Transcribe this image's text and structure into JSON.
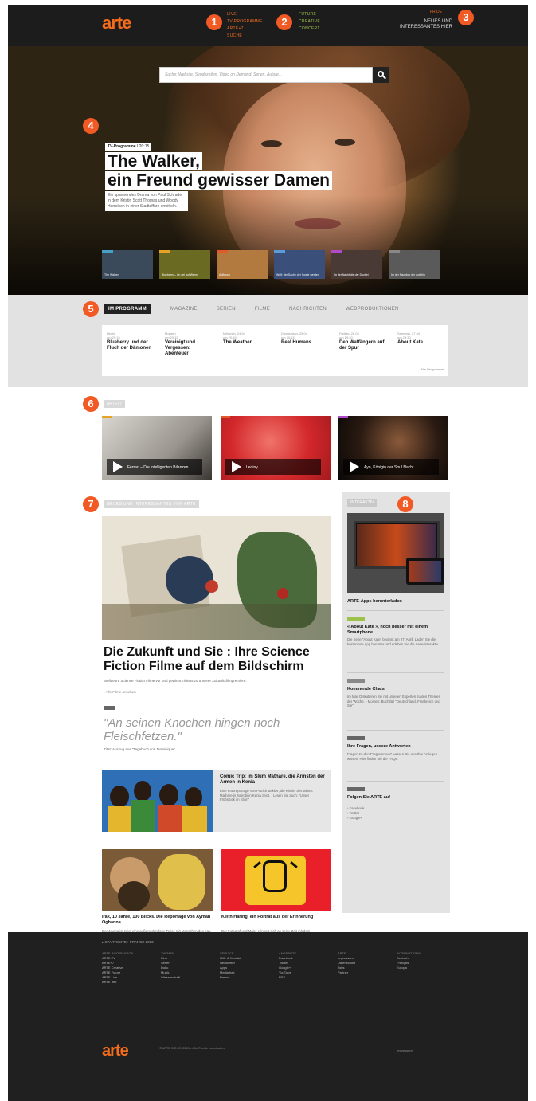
{
  "header": {
    "logo": "arte",
    "nav_col1": [
      "LIVE",
      "TV-PROGRAMME",
      "ARTE+7",
      "SUCHE"
    ],
    "nav_col2": [
      "FUTURE",
      "CREATIVE",
      "CONCERT"
    ],
    "lang": "FR DE",
    "news": "NEUES UND INTERESSANTES HIER"
  },
  "badges": [
    "1",
    "2",
    "3",
    "4",
    "5",
    "6",
    "7",
    "8"
  ],
  "hero": {
    "search_placeholder": "Suche: Website, Sendezeiten, Video on Demand, Serien, Autore...",
    "kicker_label": "TV-Programme",
    "kicker_time": "I 20:15",
    "title_line1": "The Walker,",
    "title_line2": "ein Freund gewisser Damen",
    "description": "Ein spannendes Drama von Paul Schrader in dem Kristin Scott Thomas und Woody Harrelson in einer Stadtaffäre ermitteln.",
    "thumbs": [
      {
        "caption": "The Walker",
        "color": "#3a4a5a",
        "tag": "#47a0c8"
      },
      {
        "caption": "Blueberry – Un del auf Wenn",
        "color": "#6b6a22",
        "tag": "#e6a326"
      },
      {
        "caption": "Aufbruch",
        "color": "#b27a3f",
        "tag": "#e35a2a"
      },
      {
        "caption": "Wolf: der Sache der Sowie werden",
        "color": "#3a4f7a",
        "tag": "#5a9bd8"
      },
      {
        "caption": "Im der Nacht die der Dunkel",
        "color": "#4a3a36",
        "tag": "#b04ac8"
      },
      {
        "caption": "Im der Nachbar der dort hin",
        "color": "#5a5a5a",
        "tag": "#888888"
      }
    ]
  },
  "programme": {
    "tabs": [
      "IM PROGRAMM",
      "MAGAZINE",
      "SERIEN",
      "FILME",
      "NACHRICHTEN",
      "WEBPRODUKTIONEN"
    ],
    "items": [
      {
        "day": "Heute",
        "time": "um 20:15",
        "title": "Blueberry und der Fluch der Dämonen"
      },
      {
        "day": "Morgen",
        "time": "um 20:15",
        "title": "Vereinigt und Vergessen: Abenteuer"
      },
      {
        "day": "Mittwoch, 24.04",
        "time": "um 20:15",
        "title": "The Weather"
      },
      {
        "day": "Donnerstag, 25.04",
        "time": "um 20:15",
        "title": "Real Humans"
      },
      {
        "day": "Freitag, 26.04",
        "time": "um 19:30",
        "title": "Den Waffängern auf der Spur"
      },
      {
        "day": "Samstag, 27.04",
        "time": "um 23:30",
        "title": "About Kate"
      }
    ],
    "all_link": "Alle Programme"
  },
  "videos": {
    "label": "ARTE+7",
    "items": [
      {
        "title": "Ferrari – Die intelligenten Bilanzen",
        "tag": "#e6a326"
      },
      {
        "title": "Leoiny",
        "tag": "#e35a2a"
      },
      {
        "title": "Ayo, Königin der Soul Nacht",
        "tag": "#b04ac8"
      }
    ]
  },
  "articles": {
    "label": "NEUES UND INTERESSANTES VON ARTE",
    "feature_title": "Die Zukunft und Sie : Ihre Science Fiction Filme auf dem Bildschirm",
    "feature_desc": "Stellt eure Science Fiction Filme vor und gewinnt Tickets zu unserer Zukunftsfilmpremiere.",
    "feature_link": "› Alle Filme ansehen",
    "quote": "\"An seinen Knochen hingen noch Fleischfetzen.\"",
    "quote_src": "Zitat: Auszug aus \"Tagebuch von Dominique\"",
    "card1_title": "Comic Trip: Im Slum Mathare, die Ärmsten der Armen in Kenia",
    "card1_desc": "Eine Fotoreportage von Patrick Bakker, die Kinder des Slums Mathare in Nairobi in Kenia zeigt. › Lesen Sie auch: \"Unser Frühstück im Slum\"",
    "card2_title": "Irak, 10 Jahre, 100 Blicks. Die Reportage von Ayman Oghanna",
    "card2_desc": "Der Journalist zeigt eine außerordentliche Reise mit Menschen des Irak, die Freude und Leid erlebt haben.",
    "card3_title": "Keith Haring, ein Porträt aus der Erinnerung",
    "card3_desc": "Der Fotograf und Maler erinnert sich an seine Zeit mit dem amerikanischen Künstler Haring."
  },
  "sidebar": {
    "label": "INTERAKTIV",
    "apps_title": "ARTE-Apps herunterladen",
    "s1_title": "« About Kate », noch besser mit einem Smartphone",
    "s1_text": "Die Serie \"About Kate\" beginnt am 27. April. Laden Sie die kostenlose App herunter und erleben Sie die Serie interaktiv.",
    "s2_title": "Kommende Chats",
    "s2_text": "Im Mai: Diskutieren Sie mit unseren Experten zu den Themen der Woche. › Morgen: Buchtitel \"Deutschland, Frankreich und Sie\"",
    "s3_title": "Ihre Fragen, unsere Antworten",
    "s3_text": "Fragen zu den Programmen? Lassen Sie uns Ihre Anliegen wissen. Hier finden Sie die FAQs.",
    "s4_title": "Folgen Sie ARTE auf",
    "s4_links": [
      "› Facebook",
      "› Twitter",
      "› Google+"
    ],
    "tag_colors": [
      "#9cc24b",
      "#888888",
      "#666666",
      "#666666"
    ]
  },
  "footer": {
    "top_nav": "▸ STARTSEITE   ›   FRANCE 2013",
    "cols": [
      {
        "head": "ARTE INFORMATION",
        "items": [
          "ARTE.TV",
          "ARTE+7",
          "ARTE Creative",
          "ARTE Future",
          "ARTE Live",
          "ARTE Info"
        ]
      },
      {
        "head": "THEMEN",
        "items": [
          "Kino",
          "Serien",
          "Doku",
          "Musik",
          "Wissenschaft"
        ]
      },
      {
        "head": "SERVICE",
        "items": [
          "Hilfe & Kontakt",
          "Newsletter",
          "Apps",
          "Mediathek",
          "Presse"
        ]
      },
      {
        "head": "ANGEBOTE",
        "items": [
          "Facebook",
          "Twitter",
          "Google+",
          "YouTube",
          "RSS"
        ]
      },
      {
        "head": "ARTE",
        "items": [
          "Impressum",
          "Datenschutz",
          "Jobs",
          "Partner"
        ]
      },
      {
        "head": "INTERNATIONAL",
        "items": [
          "Deutsch",
          "Français",
          "Europa"
        ]
      }
    ],
    "logo": "arte",
    "copyright": "© ARTE G.E.I.E. 2013 – Alle Rechte vorbehalten",
    "right": "Impressum"
  }
}
